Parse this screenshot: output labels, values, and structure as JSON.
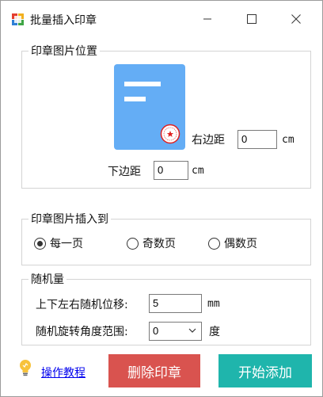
{
  "window": {
    "title": "批量插入印章"
  },
  "position_group": {
    "legend": "印章图片位置",
    "right_margin_label": "右边距",
    "right_margin_value": "0",
    "right_margin_unit": "cm",
    "bottom_margin_label": "下边距",
    "bottom_margin_value": "0",
    "bottom_margin_unit": "cm"
  },
  "insert_group": {
    "legend": "印章图片插入到",
    "options": [
      {
        "label": "每一页",
        "checked": true
      },
      {
        "label": "奇数页",
        "checked": false
      },
      {
        "label": "偶数页",
        "checked": false
      }
    ]
  },
  "random_group": {
    "legend": "随机量",
    "offset_label": "上下左右随机位移:",
    "offset_value": "5",
    "offset_unit": "mm",
    "rotate_label": "随机旋转角度范围:",
    "rotate_value": "0",
    "rotate_unit": "度"
  },
  "footer": {
    "tutorial_link": "操作教程",
    "delete_button": "删除印章",
    "start_button": "开始添加"
  },
  "colors": {
    "doc_blue": "#64adf5",
    "delete_red": "#d9534f",
    "start_teal": "#1fb5ac",
    "seal_red": "#e02020"
  },
  "icons": {
    "app": "app-icon",
    "bulb": "lightbulb-icon",
    "minimize": "minimize-icon",
    "maximize": "maximize-icon",
    "close": "close-icon",
    "dropdown": "chevron-down-icon"
  }
}
